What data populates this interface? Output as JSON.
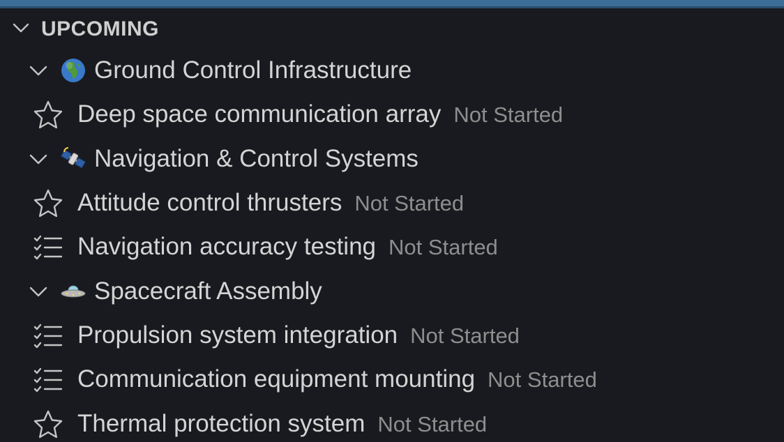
{
  "section": {
    "title": "UPCOMING"
  },
  "groups": [
    {
      "emoji_icon": "globe-africa-icon",
      "label": "Ground Control Infrastructure",
      "items": [
        {
          "icon": "star-icon",
          "label": "Deep space communication array",
          "status": "Not Started"
        }
      ]
    },
    {
      "emoji_icon": "satellite-icon",
      "label": "Navigation & Control Systems",
      "items": [
        {
          "icon": "star-icon",
          "label": "Attitude control thrusters",
          "status": "Not Started"
        },
        {
          "icon": "checklist-icon",
          "label": "Navigation accuracy testing",
          "status": "Not Started"
        }
      ]
    },
    {
      "emoji_icon": "flying-saucer-icon",
      "label": "Spacecraft Assembly",
      "items": [
        {
          "icon": "checklist-icon",
          "label": "Propulsion system integration",
          "status": "Not Started"
        },
        {
          "icon": "checklist-icon",
          "label": "Communication equipment mounting",
          "status": "Not Started"
        },
        {
          "icon": "star-icon",
          "label": "Thermal protection system",
          "status": "Not Started"
        }
      ]
    }
  ],
  "colors": {
    "background": "#181a1f",
    "accent_bar": "#3b6e98",
    "text": "#d4d4d4",
    "status_text": "#8e8e8e"
  }
}
